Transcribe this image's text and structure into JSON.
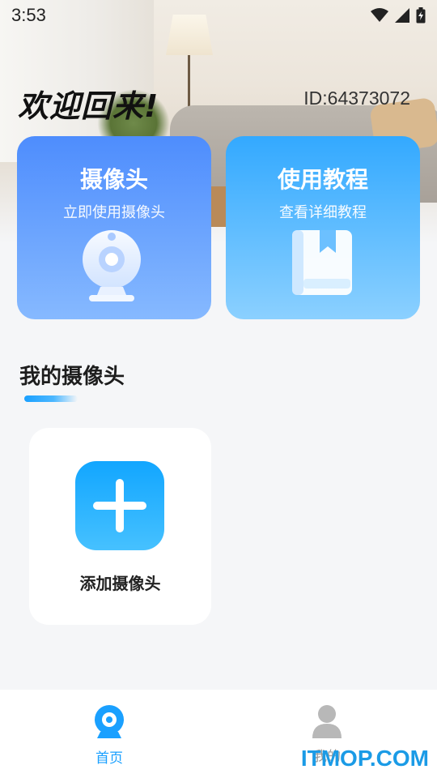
{
  "status_bar": {
    "time": "3:53",
    "icons": [
      "wifi-icon",
      "cell-signal-icon",
      "battery-charging-icon"
    ]
  },
  "header": {
    "welcome": "欢迎回来!",
    "user_id": "ID:64373072"
  },
  "cards": [
    {
      "title": "摄像头",
      "subtitle": "立即使用摄像头",
      "icon": "webcam-icon"
    },
    {
      "title": "使用教程",
      "subtitle": "查看详细教程",
      "icon": "book-icon"
    }
  ],
  "section": {
    "title": "我的摄像头"
  },
  "add_camera": {
    "label": "添加摄像头",
    "icon": "plus-icon"
  },
  "tabbar": {
    "items": [
      {
        "label": "首页",
        "icon": "home-camera-icon",
        "active": true
      },
      {
        "label": "我的",
        "icon": "user-icon",
        "active": false
      }
    ]
  },
  "watermark": "ITMOP.COM",
  "colors": {
    "accent": "#1aa0ff",
    "card_camera": "#4e8dfd",
    "card_tutorial": "#33a9ff"
  }
}
